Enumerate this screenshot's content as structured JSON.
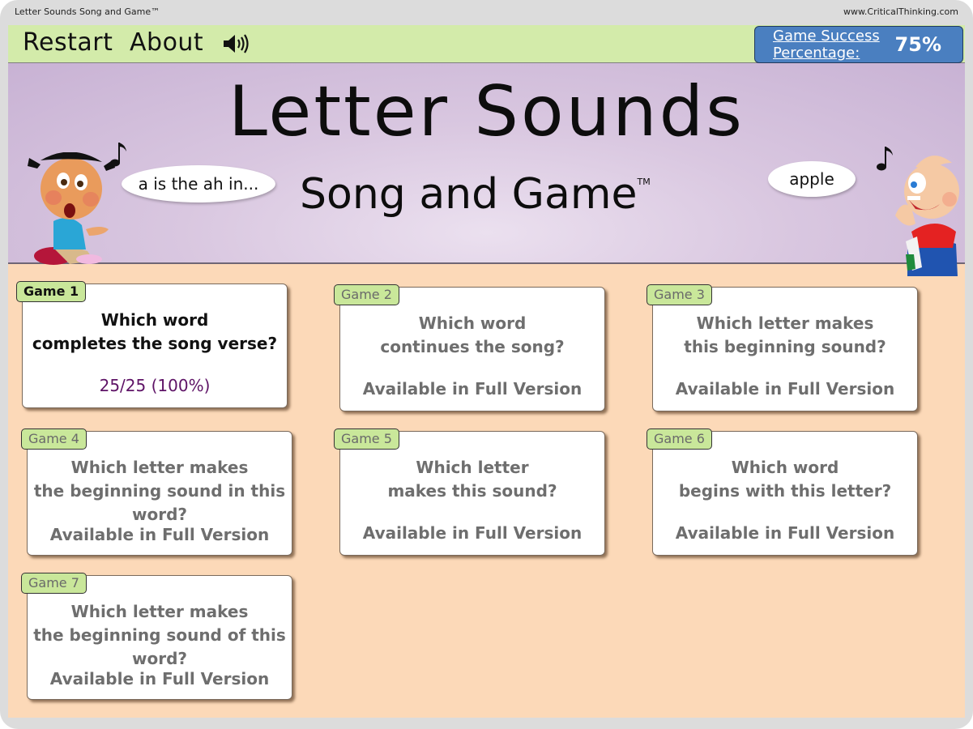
{
  "window": {
    "title": "Letter Sounds Song and Game™",
    "site": "www.CriticalThinking.com"
  },
  "toolbar": {
    "restart_label": "Restart",
    "about_label": "About",
    "sound_icon": "speaker-icon",
    "score_label_line1": "Game Success",
    "score_label_line2": "Percentage:",
    "score_value": "75%"
  },
  "banner": {
    "title": "Letter Sounds",
    "subtitle": "Song and Game",
    "trademark": "TM",
    "left_bubble": "a is the ah in...",
    "right_bubble": "apple"
  },
  "colors": {
    "toolbar_bg": "#d3ebaa",
    "score_bg": "#4a7fc0",
    "page_bg": "#fcd9b8",
    "tag_bg": "#c9e79a",
    "result_text": "#5e1366"
  },
  "games": [
    {
      "tag": "Game 1",
      "question_line1": "Which word",
      "question_line2": "completes the song verse?",
      "status": "25/25 (100%)",
      "active": true
    },
    {
      "tag": "Game 2",
      "question_line1": "Which word",
      "question_line2": "continues the song?",
      "status": "Available in Full Version",
      "active": false
    },
    {
      "tag": "Game 3",
      "question_line1": "Which letter makes",
      "question_line2": "this beginning sound?",
      "status": "Available in Full Version",
      "active": false
    },
    {
      "tag": "Game 4",
      "question_line1": "Which letter makes",
      "question_line2": "the beginning sound in this word?",
      "status": "Available in Full Version",
      "active": false
    },
    {
      "tag": "Game 5",
      "question_line1": "Which letter",
      "question_line2": "makes this sound?",
      "status": "Available in Full Version",
      "active": false
    },
    {
      "tag": "Game 6",
      "question_line1": "Which word",
      "question_line2": "begins with this letter?",
      "status": "Available in Full Version",
      "active": false
    },
    {
      "tag": "Game 7",
      "question_line1": "Which letter makes",
      "question_line2": "the beginning sound of this word?",
      "status": "Available in Full Version",
      "active": false
    }
  ]
}
